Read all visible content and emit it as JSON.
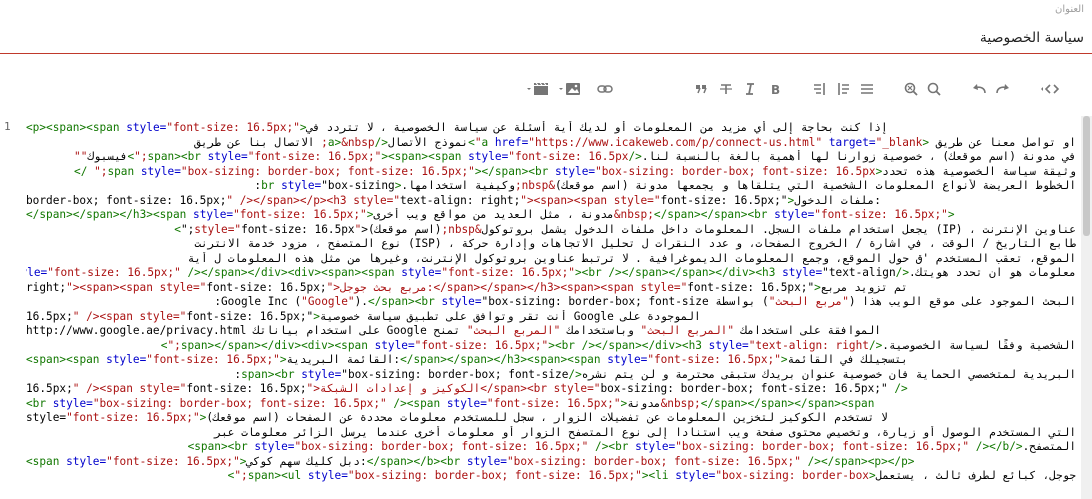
{
  "title_field": {
    "label": "العنوان",
    "value": "سياسة الخصوصية"
  },
  "toolbar": {
    "buttons": [
      {
        "id": "code",
        "icon": "code-view-icon"
      },
      {
        "id": "undo",
        "icon": "undo-icon"
      },
      {
        "id": "redo",
        "icon": "redo-icon"
      },
      {
        "id": "search",
        "icon": "search-icon"
      },
      {
        "id": "search-replace",
        "icon": "search-replace-icon"
      },
      {
        "id": "align",
        "icon": "align-icon"
      },
      {
        "id": "align-right",
        "icon": "align-right-icon"
      },
      {
        "id": "align-left",
        "icon": "align-left-icon"
      },
      {
        "id": "bold",
        "icon": "bold-icon"
      },
      {
        "id": "italic",
        "icon": "italic-icon"
      },
      {
        "id": "strike",
        "icon": "strikethrough-icon"
      },
      {
        "id": "quote",
        "icon": "quote-icon"
      },
      {
        "id": "link",
        "icon": "link-icon"
      },
      {
        "id": "image",
        "icon": "image-icon"
      },
      {
        "id": "media",
        "icon": "media-icon"
      }
    ]
  },
  "editor": {
    "line_number": "1",
    "lines": [
      "<p><span><span style=\"font-size: 16.5px;\">إذا كنت بحاجة إلى أي مزيد من المعلومات أو لديك أية أسئلة عن سياسة الخصوصية ، لا تتردد في",
      "او تواصل معنا عن طريق <a href=\"https://www.icakeweb.com/p/connect-us.html\" target=\"_blank\">نموذج الأتصال</a>&nbsp; الاتصال بنا عن طريق",
      "في مدونة (اسم موقعك) ، خصوصية زوارنا لها أهمية بالغة بالنسبة لنا.</span><br style=\"font-size: 16.5px;\"><span><span style=\"font-size: 16.5px;\">فيسبوك\"\"",
      "وثيقة سياسة الخصوصية هذه تحدد<span style=\"box-sizing: border-box; font-size: 16.5px;\"></span><br style=\"box-sizing: border-box; font-size: 16.5px;\" />",
      "الخطوط العريضة لأنواع المعلومات الشخصية التي يتلقاها و يجمعها مدونة (اسم موقعك)&nbsp;وكيفية استخدامها.<br style=\"box-sizing:",
      "border-box; font-size: 16.5px;\" /></span></p><h3 style=\"text-align: right;\"><span><span style=\"font-size: 16.5px;\">ملفات الدخول:",
      "</span></span></h3><span style=\"font-size: 16.5px;\">مدونة ، مثل العديد من مواقع ويب أخرى&nbsp;</span></span><br style=\"font-size: 16.5px;\">",
      "عناوين الإنترنت ، (IP) يجعل استخدام ملفات السجل. المعلومات داخل ملفات الدخول يشمل بروتوكول&nbsp;(اسم موقعك)<\"style=\"font-size: 16.5px;\">",
      "طابع التاريخ / الوقت ، في اشارة / الخروج الصفحات، و عدد النقرات ل تحليل الاتجاهات وإدارة حركة ، (ISP) نوع المتصفح ، مزود خدمة الانترنت",
      "الموقع، تعقب المستخدم 'ق حول الموقع، وجمع المعلومات الديموغرافية . لا ترتبط عناوين بروتوكول الإنترنت، وغيرها من مثل هذه المعلومات ل أية",
      "معلومات هو ان تحدد هويتك.</span><br style=\"font-size: 16.5px;\" /></span></div><div><span><span style=\"font-size: 16.5px;\"><br /></span></span></div><h3 style=\"text-align:",
      "right;\"><span><span style=\"font-size: 16.5px;\">مربع بحث جوجل:</span></span></h3><span><span style=\"font-size: 16.5px;\">تم تزويد مربع",
      "البحث الموجود على موقع الويب هذا (\"مربع البحث\") بواسطة Google Inc (\"Google\").</span><br style=\"box-sizing: border-box; font-size:",
      "16.5px;\" /><span style=\"font-size: 16.5px;\">أنت تقر وتوافق على تطبيق سياسة خصوصية Google الموجودة على",
      "http://www.google.ae/privacy.html على استخدام بياناتك Google الموافقة على استخدامك \"المربع البحث\" وباستخدامك \"المربع البحث\" تمنح",
      "الشخصية وفقًا لسياسة الخصوصية.</span></span></div><div><span style=\"font-size: 16.5px;\"><br /></span></div><h3 style=\"text-align: right;\">",
      "<span><span style=\"font-size: 16.5px;\">القائمة البريدية:</span></span></h3><span><span style=\"font-size: 16.5px;\">بتسجيلك في القائمة",
      "البريدية لمتخصصي الحماية فان خصوصية عنوان بريدك ستبقى محترمة و لن يتم نشره</span><br style=\"box-sizing: border-box; font-size:",
      "16.5px;\" /><span style=\"font-size: 16.5px;\">الكوكيز و إعدادات الشبكة</span><br style=\"box-sizing: border-box; font-size: 16.5px;\" />",
      "<br style=\"box-sizing: border-box; font-size: 16.5px;\" /><span style=\"font-size: 16.5px;\">مدونة&nbsp;</span></span></span><span",
      "style=\"font-size: 16.5px;\">(اسم موقعك) لا تستخدم الكوكيز لتخزين المعلومات عن تفضيلات الزوار ، سجل للمستخدم معلومات محددة عن الصفحات",
      "التي المستخدم الوصول أو زيارة، وتخصيص محتوى صفحة ويب استنادا إلى نوع المتصفح الزوار أو معلومات أخرى عندما يرسل الزائر معلومات عبر",
      "المتصفح.</span><br style=\"box-sizing: border-box; font-size: 16.5px;\" /><br style=\"box-sizing: border-box; font-size: 16.5px;\" /></b>",
      "<span style=\"font-size: 16.5px;\">دبل كليك سهم كوكي:</span></b><br style=\"box-sizing: border-box; font-size: 16.5px;\" /></span><p></p>",
      "جوجل، كبائع لطرف ثالث ، يستعمل<span><ul style=\"box-sizing: border-box; font-size: 16.5px;\"><li style=\"box-sizing: border-box;\">"
    ]
  }
}
